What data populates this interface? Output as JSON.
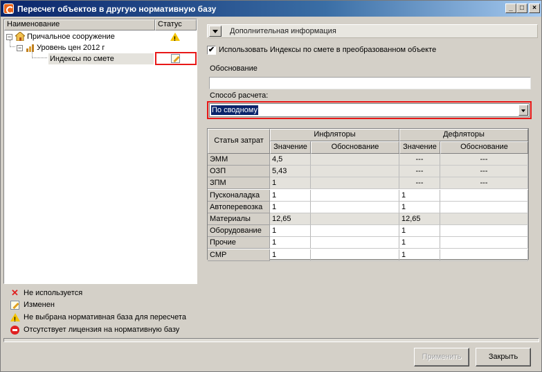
{
  "window": {
    "title": "Пересчет объектов в другую нормативную базу",
    "buttons": {
      "minimize": "_",
      "maximize": "□",
      "close": "×"
    }
  },
  "tree": {
    "columns": [
      "Наименование",
      "Статус"
    ],
    "nodes": [
      {
        "label": "Причальное сооружение",
        "icon": "house-icon",
        "status_icon": "warning-icon"
      },
      {
        "label": "Уровень цен 2012 г",
        "icon": "price-level-icon"
      },
      {
        "label": "Индексы по смете",
        "status_icon": "pencil-icon"
      }
    ]
  },
  "legend": [
    {
      "icon": "x-icon",
      "text": "Не используется"
    },
    {
      "icon": "pencil-icon",
      "text": "Изменен"
    },
    {
      "icon": "warning-icon",
      "text": "Не выбрана нормативная база для пересчета"
    },
    {
      "icon": "no-entry-icon",
      "text": "Отсутствует лицензия на нормативную базу"
    }
  ],
  "details": {
    "section_label": "Дополнительная информация",
    "use_indexes_label": "Использовать Индексы по смете в преобразованном объекте",
    "use_indexes_checked": true,
    "justification_label": "Обоснование",
    "justification_value": "",
    "method_label": "Способ расчета:",
    "method_value": "По сводному"
  },
  "grid": {
    "col_article": "Статья затрат",
    "group_inflators": "Инфляторы",
    "group_deflators": "Дефляторы",
    "col_value": "Значение",
    "col_justification": "Обоснование",
    "rows": [
      {
        "name": "ЭММ",
        "inf_value": "4,5",
        "inf_just": "",
        "def_value": "---",
        "def_just": "---",
        "readonly": true
      },
      {
        "name": "ОЗП",
        "inf_value": "5,43",
        "inf_just": "",
        "def_value": "---",
        "def_just": "---",
        "readonly": true
      },
      {
        "name": "ЗПМ",
        "inf_value": "1",
        "inf_just": "",
        "def_value": "---",
        "def_just": "---",
        "readonly": true
      },
      {
        "name": "Пусконаладка",
        "inf_value": "1",
        "inf_just": "",
        "def_value": "1",
        "def_just": "",
        "readonly": false
      },
      {
        "name": "Автоперевозка",
        "inf_value": "1",
        "inf_just": "",
        "def_value": "1",
        "def_just": "",
        "readonly": false
      },
      {
        "name": "Материалы",
        "inf_value": "12,65",
        "inf_just": "",
        "def_value": "12,65",
        "def_just": "",
        "readonly": true
      },
      {
        "name": "Оборудование",
        "inf_value": "1",
        "inf_just": "",
        "def_value": "1",
        "def_just": "",
        "readonly": false
      },
      {
        "name": "Прочие",
        "inf_value": "1",
        "inf_just": "",
        "def_value": "1",
        "def_just": "",
        "readonly": false
      },
      {
        "name": "СМР",
        "inf_value": "1",
        "inf_just": "",
        "def_value": "1",
        "def_just": "",
        "readonly": false
      }
    ]
  },
  "footer": {
    "apply_label": "Применить",
    "apply_enabled": false,
    "close_label": "Закрыть"
  }
}
